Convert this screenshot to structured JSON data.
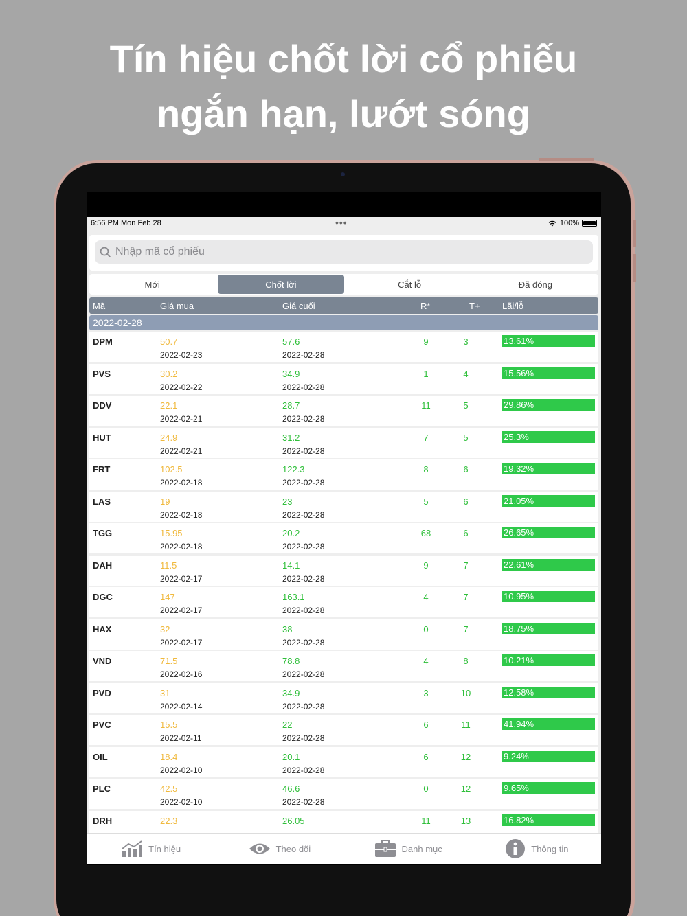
{
  "headline": {
    "line1": "Tín hiệu chốt lời cổ phiếu",
    "line2": "ngắn hạn, lướt sóng"
  },
  "statusbar": {
    "time": "6:56 PM   Mon Feb 28",
    "dots": "•••",
    "battery": "100%"
  },
  "search": {
    "placeholder": "Nhập mã cổ phiếu"
  },
  "tabs": [
    "Mới",
    "Chốt lời",
    "Cắt lỗ",
    "Đã đóng"
  ],
  "active_tab": "Chốt lời",
  "table": {
    "headers": {
      "ma": "Mã",
      "gia_mua": "Giá mua",
      "gia_cuoi": "Giá cuối",
      "r": "R*",
      "t": "T+",
      "lai_lo": "Lãi/lỗ"
    },
    "group_date": "2022-02-28",
    "rows": [
      {
        "ma": "DPM",
        "buy": "50.7",
        "buy_date": "2022-02-23",
        "last": "57.6",
        "last_date": "2022-02-28",
        "r": "9",
        "t": "3",
        "pl": "13.61%"
      },
      {
        "ma": "PVS",
        "buy": "30.2",
        "buy_date": "2022-02-22",
        "last": "34.9",
        "last_date": "2022-02-28",
        "r": "1",
        "t": "4",
        "pl": "15.56%"
      },
      {
        "ma": "DDV",
        "buy": "22.1",
        "buy_date": "2022-02-21",
        "last": "28.7",
        "last_date": "2022-02-28",
        "r": "11",
        "t": "5",
        "pl": "29.86%"
      },
      {
        "ma": "HUT",
        "buy": "24.9",
        "buy_date": "2022-02-21",
        "last": "31.2",
        "last_date": "2022-02-28",
        "r": "7",
        "t": "5",
        "pl": "25.3%"
      },
      {
        "ma": "FRT",
        "buy": "102.5",
        "buy_date": "2022-02-18",
        "last": "122.3",
        "last_date": "2022-02-28",
        "r": "8",
        "t": "6",
        "pl": "19.32%"
      },
      {
        "ma": "LAS",
        "buy": "19",
        "buy_date": "2022-02-18",
        "last": "23",
        "last_date": "2022-02-28",
        "r": "5",
        "t": "6",
        "pl": "21.05%"
      },
      {
        "ma": "TGG",
        "buy": "15.95",
        "buy_date": "2022-02-18",
        "last": "20.2",
        "last_date": "2022-02-28",
        "r": "68",
        "t": "6",
        "pl": "26.65%"
      },
      {
        "ma": "DAH",
        "buy": "11.5",
        "buy_date": "2022-02-17",
        "last": "14.1",
        "last_date": "2022-02-28",
        "r": "9",
        "t": "7",
        "pl": "22.61%"
      },
      {
        "ma": "DGC",
        "buy": "147",
        "buy_date": "2022-02-17",
        "last": "163.1",
        "last_date": "2022-02-28",
        "r": "4",
        "t": "7",
        "pl": "10.95%"
      },
      {
        "ma": "HAX",
        "buy": "32",
        "buy_date": "2022-02-17",
        "last": "38",
        "last_date": "2022-02-28",
        "r": "0",
        "t": "7",
        "pl": "18.75%"
      },
      {
        "ma": "VND",
        "buy": "71.5",
        "buy_date": "2022-02-16",
        "last": "78.8",
        "last_date": "2022-02-28",
        "r": "4",
        "t": "8",
        "pl": "10.21%"
      },
      {
        "ma": "PVD",
        "buy": "31",
        "buy_date": "2022-02-14",
        "last": "34.9",
        "last_date": "2022-02-28",
        "r": "3",
        "t": "10",
        "pl": "12.58%"
      },
      {
        "ma": "PVC",
        "buy": "15.5",
        "buy_date": "2022-02-11",
        "last": "22",
        "last_date": "2022-02-28",
        "r": "6",
        "t": "11",
        "pl": "41.94%"
      },
      {
        "ma": "OIL",
        "buy": "18.4",
        "buy_date": "2022-02-10",
        "last": "20.1",
        "last_date": "2022-02-28",
        "r": "6",
        "t": "12",
        "pl": "9.24%"
      },
      {
        "ma": "PLC",
        "buy": "42.5",
        "buy_date": "2022-02-10",
        "last": "46.6",
        "last_date": "2022-02-28",
        "r": "0",
        "t": "12",
        "pl": "9.65%"
      },
      {
        "ma": "DRH",
        "buy": "22.3",
        "buy_date": "",
        "last": "26.05",
        "last_date": "",
        "r": "11",
        "t": "13",
        "pl": "16.82%"
      }
    ]
  },
  "tabbar": [
    {
      "label": "Tín hiệu",
      "icon": "chart-icon"
    },
    {
      "label": "Theo dõi",
      "icon": "eye-icon"
    },
    {
      "label": "Danh mục",
      "icon": "briefcase-icon"
    },
    {
      "label": "Thông tin",
      "icon": "info-icon"
    }
  ],
  "colors": {
    "buy_price": "#f0b93d",
    "last_price": "#2fbf3a",
    "profit_bar": "#2fc94a",
    "header_bg": "#7a8593",
    "group_bg": "#8e9db4"
  }
}
